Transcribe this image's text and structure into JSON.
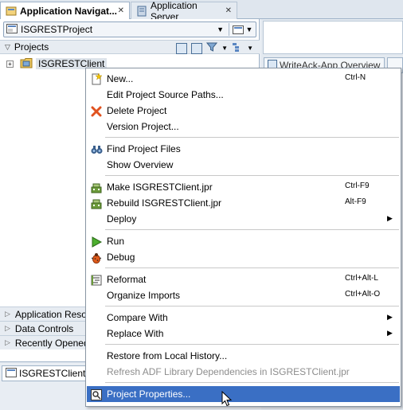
{
  "tabs": {
    "application_navigator": "Application Navigat...",
    "application_server": "Application Server"
  },
  "navigator": {
    "project_selector": "ISGRESTProject",
    "projects_header": "Projects",
    "tree_item": "ISGRESTClient",
    "accordion": [
      "Application Resou",
      "Data Controls",
      "Recently Opened"
    ],
    "bottom_tab": "ISGRESTClient.jpr"
  },
  "editor": {
    "tab_label": "WriteAck-App Overview"
  },
  "context_menu": {
    "items": [
      {
        "label": "New...",
        "shortcut": "Ctrl-N",
        "icon": "new-file-icon"
      },
      {
        "label": "Edit Project Source Paths...",
        "shortcut": "",
        "icon": ""
      },
      {
        "label": "Delete Project",
        "shortcut": "",
        "icon": "delete-x-icon"
      },
      {
        "label": "Version Project...",
        "shortcut": "",
        "icon": ""
      },
      {
        "label": "Find Project Files",
        "shortcut": "",
        "icon": "binoculars-icon"
      },
      {
        "label": "Show Overview",
        "shortcut": "",
        "icon": ""
      },
      {
        "label": "Make ISGRESTClient.jpr",
        "shortcut": "Ctrl-F9",
        "icon": "make-icon"
      },
      {
        "label": "Rebuild ISGRESTClient.jpr",
        "shortcut": "Alt-F9",
        "icon": "rebuild-icon"
      },
      {
        "label": "Deploy",
        "shortcut": "",
        "icon": ""
      },
      {
        "label": "Run",
        "shortcut": "",
        "icon": "run-icon"
      },
      {
        "label": "Debug",
        "shortcut": "",
        "icon": "debug-bug-icon"
      },
      {
        "label": "Reformat",
        "shortcut": "Ctrl+Alt-L",
        "icon": "reformat-icon"
      },
      {
        "label": "Organize Imports",
        "shortcut": "Ctrl+Alt-O",
        "icon": ""
      },
      {
        "label": "Compare With",
        "shortcut": "",
        "icon": ""
      },
      {
        "label": "Replace With",
        "shortcut": "",
        "icon": ""
      },
      {
        "label": "Restore from Local History...",
        "shortcut": "",
        "icon": ""
      },
      {
        "label": "Refresh ADF Library Dependencies in ISGRESTClient.jpr",
        "shortcut": "",
        "icon": ""
      },
      {
        "label": "Project Properties...",
        "shortcut": "",
        "icon": "properties-icon"
      }
    ]
  },
  "colors": {
    "selection": "#3a6fc4",
    "panel_border": "#9fb3c8",
    "disabled_text": "#8d8d8d"
  }
}
